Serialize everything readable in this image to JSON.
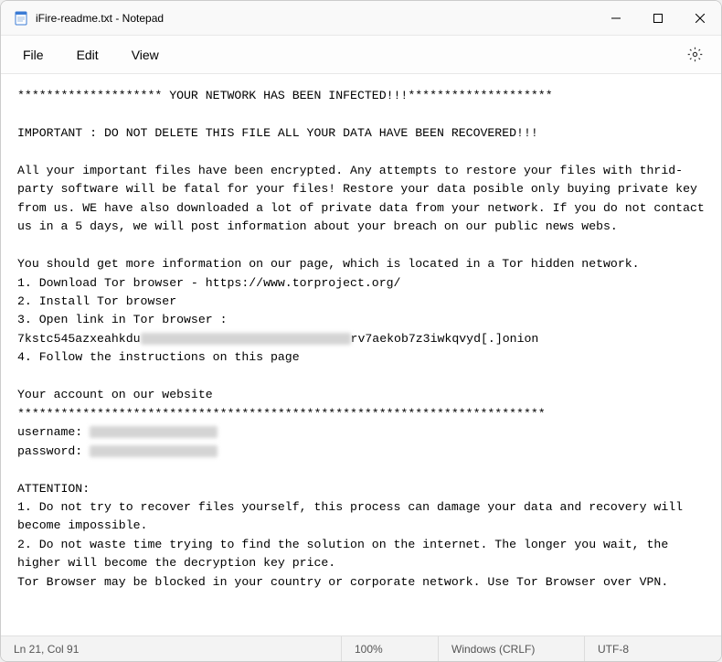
{
  "titlebar": {
    "title": "iFire-readme.txt - Notepad"
  },
  "menubar": {
    "file": "File",
    "edit": "Edit",
    "view": "View"
  },
  "content": {
    "line1": "******************** YOUR NETWORK HAS BEEN INFECTED!!!********************",
    "line3": "IMPORTANT : DO NOT DELETE THIS FILE ALL YOUR DATA HAVE BEEN RECOVERED!!!",
    "para1": "All your important files have been encrypted. Any attempts to restore your files with thrid-party software will be fatal for your files! Restore your data posible only buying private key from us. WE have also downloaded a lot of private data from your network. If you do not contact us in a 5 days, we will post information about your breach on our public news webs.",
    "para2a": "You should get more information on our page, which is located in a Tor hidden network.",
    "step1": "1. Download Tor browser - https://www.torproject.org/",
    "step2": "2. Install Tor browser",
    "step3": "3. Open link in Tor browser :",
    "onion_a": "7kstc545azxeahkdu",
    "onion_b": "rv7aekob7z3iwkqvyd[.]onion",
    "step4": "4. Follow the instructions on this page",
    "acct_header": "Your account on our website",
    "divider": "*************************************************************************",
    "username_label": "username: ",
    "password_label": "password: ",
    "att_header": "ATTENTION:",
    "att1": "1. Do not try to recover files yourself, this process can damage your data and recovery will become impossible.",
    "att2": "2. Do not waste time trying to find the solution on the internet. The longer you wait, the higher will become the decryption key price.",
    "att3": "Tor Browser may be blocked in your country or corporate network. Use Tor Browser over VPN."
  },
  "statusbar": {
    "pos": "Ln 21, Col 91",
    "zoom": "100%",
    "eol": "Windows (CRLF)",
    "enc": "UTF-8"
  }
}
